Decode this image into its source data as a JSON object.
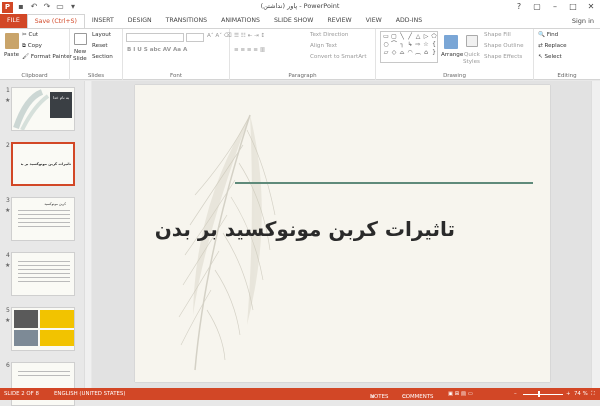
{
  "window": {
    "title": "پاور (نداشتن) - PowerPoint",
    "app_icon": "P",
    "controls": [
      "?",
      "▢",
      "–",
      "□",
      "✕"
    ]
  },
  "tabs": [
    "FILE",
    "Save (Ctrl+S)",
    "INSERT",
    "DESIGN",
    "TRANSITIONS",
    "ANIMATIONS",
    "SLIDE SHOW",
    "REVIEW",
    "VIEW",
    "ADD-INS"
  ],
  "signin": "Sign in",
  "ribbon": {
    "clipboard": {
      "paste": "Paste",
      "cut": "Cut",
      "copy": "Copy",
      "format_painter": "Format Painter",
      "label": "Clipboard"
    },
    "slides": {
      "new_slide": "New",
      "new_slide2": "Slide",
      "layout": "Layout",
      "reset": "Reset",
      "section": "Section",
      "label": "Slides"
    },
    "font": {
      "label": "Font"
    },
    "paragraph": {
      "text_direction": "Text Direction",
      "align_text": "Align Text",
      "convert_smartart": "Convert to SmartArt",
      "label": "Paragraph"
    },
    "drawing": {
      "arrange": "Arrange",
      "quick_styles": "Quick",
      "quick_styles2": "Styles",
      "shape_fill": "Shape Fill",
      "shape_outline": "Shape Outline",
      "shape_effects": "Shape Effects",
      "label": "Drawing"
    },
    "editing": {
      "find": "Find",
      "replace": "Replace",
      "select": "Select",
      "label": "Editing"
    }
  },
  "thumbnails": [
    {
      "num": "1",
      "star": "★",
      "text": "به نام خدا"
    },
    {
      "num": "2",
      "star": "",
      "text": "تاثیرات کربن مونوکسید بر بدن"
    },
    {
      "num": "3",
      "star": "★",
      "text": "کربن مونوکسید"
    },
    {
      "num": "4",
      "star": "★",
      "text": ""
    },
    {
      "num": "5",
      "star": "★",
      "text": ""
    },
    {
      "num": "6",
      "star": "",
      "text": ""
    }
  ],
  "slide": {
    "title": "تاثیرات کربن مونوکسید بر بدن"
  },
  "status": {
    "slide_of": "SLIDE 2 OF 8",
    "language": "ENGLISH (UNITED STATES)",
    "notes": "NOTES",
    "comments": "COMMENTS",
    "zoom": "74 %"
  },
  "colors": {
    "accent": "#d24726",
    "title_line": "#5f8a7a"
  }
}
